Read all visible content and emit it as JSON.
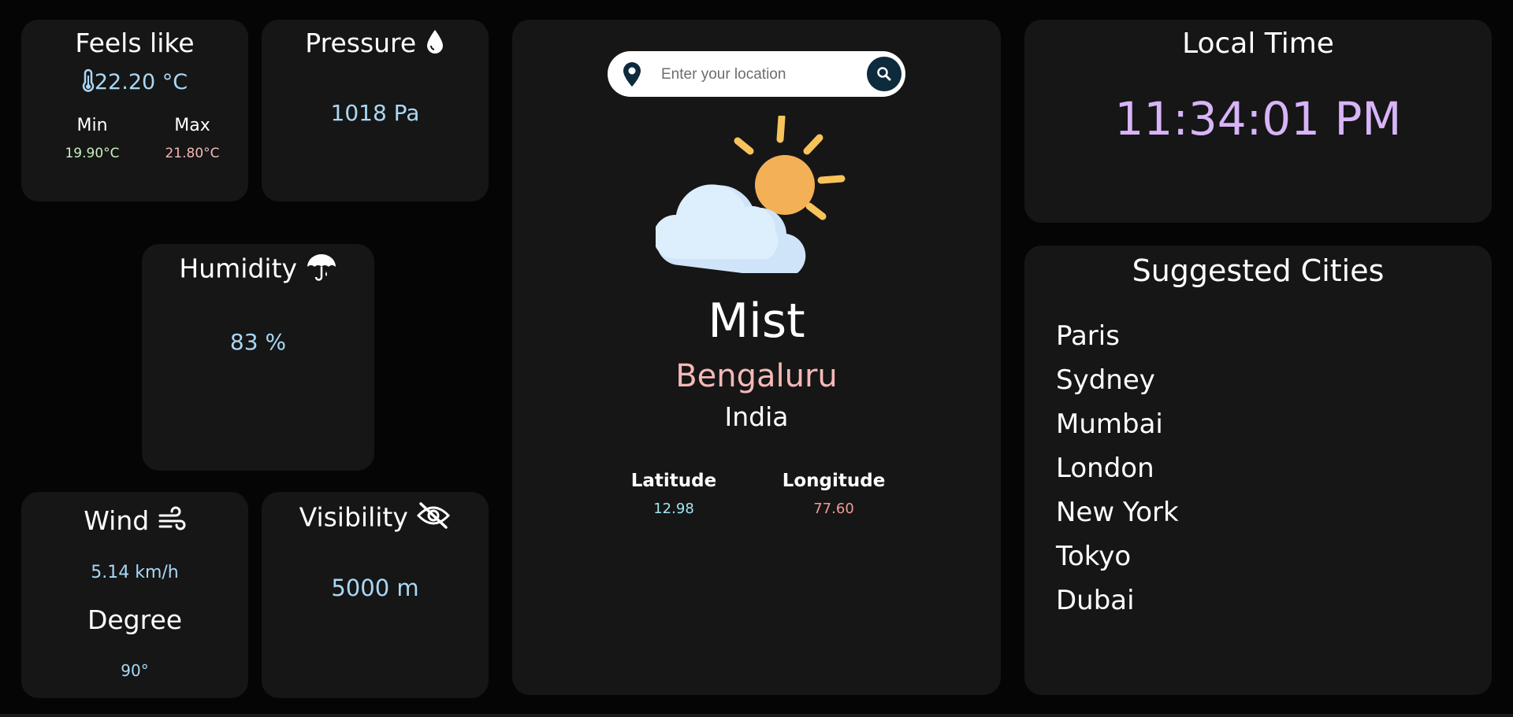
{
  "feels_like": {
    "title": "Feels like",
    "value": "22.20 °C",
    "min_label": "Min",
    "min_value": "19.90°C",
    "max_label": "Max",
    "max_value": "21.80°C",
    "icon": "thermometer-icon"
  },
  "pressure": {
    "title": "Pressure",
    "value": "1018 Pa",
    "icon": "water-drop-icon"
  },
  "humidity": {
    "title": "Humidity",
    "value": "83 %",
    "icon": "umbrella-icon"
  },
  "wind": {
    "title": "Wind",
    "speed": "5.14 km/h",
    "degree_label": "Degree",
    "degree_value": "90°",
    "icon": "wind-icon"
  },
  "visibility": {
    "title": "Visibility",
    "value": "5000 m",
    "icon": "eye-slash-icon"
  },
  "main": {
    "search_placeholder": "Enter your location",
    "weather_icon": "partly-cloudy-icon",
    "condition": "Mist",
    "city": "Bengaluru",
    "country": "India",
    "latitude_label": "Latitude",
    "latitude_value": "12.98",
    "longitude_label": "Longitude",
    "longitude_value": "77.60"
  },
  "local_time": {
    "title": "Local Time",
    "value": "11:34:01 PM"
  },
  "suggested": {
    "title": "Suggested Cities",
    "cities": [
      "Paris",
      "Sydney",
      "Mumbai",
      "London",
      "New York",
      "Tokyo",
      "Dubai"
    ]
  },
  "colors": {
    "background": "#050505",
    "card": "#161616",
    "accent_blue": "#a9d8f5",
    "accent_pink": "#f6b8b8",
    "accent_green": "#c8f0c0",
    "accent_cyan": "#9ee7f0",
    "accent_red": "#f29a9a",
    "time_purple": "#d8b4f8",
    "search_button": "#0e2a3d"
  }
}
